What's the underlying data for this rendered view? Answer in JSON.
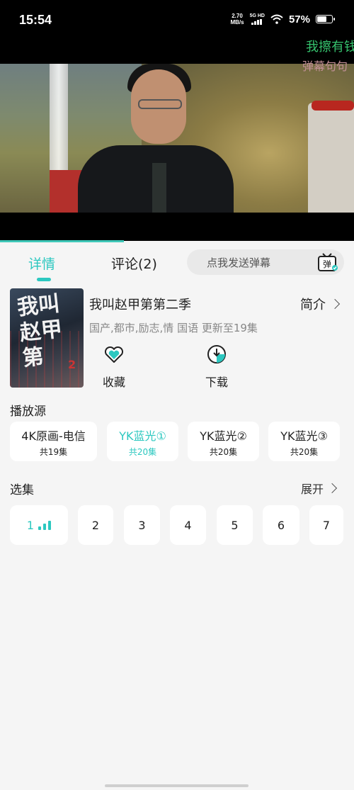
{
  "status_bar": {
    "time": "15:54",
    "net_speed_value": "2.70",
    "net_speed_unit": "MB/s",
    "net_type": "5G HD",
    "battery": "57%",
    "battery_level": 0.57
  },
  "player": {
    "danmaku": [
      "我擦有钱",
      "弹幕句句"
    ],
    "progress": 0.35
  },
  "tabs": {
    "detail": "详情",
    "comments": "评论(2)",
    "danmaku_placeholder": "点我发送弹幕",
    "danmaku_icon_label": "弹"
  },
  "show": {
    "poster_text": "我叫赵甲第",
    "poster_sub": "2",
    "title": "我叫赵甲第第二季",
    "intro": "简介",
    "meta": "国产,都市,励志,情 国语 更新至19集",
    "actions": {
      "favorite": "收藏",
      "download": "下载"
    }
  },
  "sources": {
    "title": "播放源",
    "items": [
      {
        "name": "4K原画-电信",
        "count": "共19集",
        "active": false
      },
      {
        "name": "YK蓝光①",
        "count": "共20集",
        "active": true
      },
      {
        "name": "YK蓝光②",
        "count": "共20集",
        "active": false
      },
      {
        "name": "YK蓝光③",
        "count": "共20集",
        "active": false
      }
    ]
  },
  "episodes": {
    "title": "选集",
    "expand": "展开",
    "items": [
      "1",
      "2",
      "3",
      "4",
      "5",
      "6",
      "7"
    ],
    "active_index": 0
  },
  "colors": {
    "accent": "#2cc8c0",
    "background": "#f5f5f5",
    "danmaku_green": "#35c26d"
  }
}
